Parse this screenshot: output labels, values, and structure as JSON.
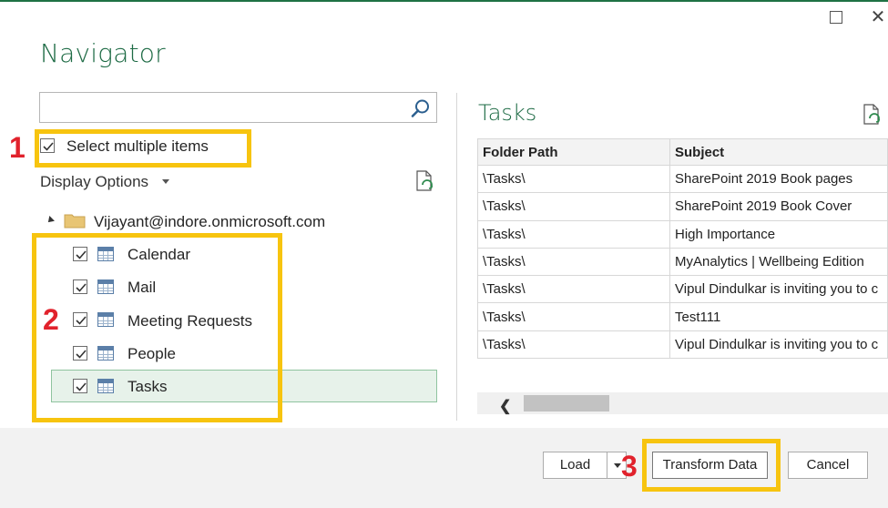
{
  "window": {
    "title": "Navigator",
    "maximize_icon": "maximize-icon",
    "close_icon": "close-icon",
    "close_glyph": "✕"
  },
  "search": {
    "value": "",
    "placeholder": "",
    "icon": "search-icon"
  },
  "select_multiple": {
    "label": "Select multiple items",
    "checked": true
  },
  "display_options": {
    "label": "Display Options"
  },
  "tree": {
    "root": {
      "label": "Vijayant@indore.onmicrosoft.com",
      "expanded": true,
      "icon": "folder-icon"
    },
    "items": [
      {
        "label": "Calendar",
        "checked": true,
        "selected": false,
        "icon": "table-icon"
      },
      {
        "label": "Mail",
        "checked": true,
        "selected": false,
        "icon": "table-icon"
      },
      {
        "label": "Meeting Requests",
        "checked": true,
        "selected": false,
        "icon": "table-icon"
      },
      {
        "label": "People",
        "checked": true,
        "selected": false,
        "icon": "table-icon"
      },
      {
        "label": "Tasks",
        "checked": true,
        "selected": true,
        "icon": "table-icon"
      }
    ]
  },
  "preview": {
    "title": "Tasks",
    "columns": [
      "Folder Path",
      "Subject"
    ],
    "rows": [
      [
        "\\Tasks\\",
        "SharePoint 2019 Book pages"
      ],
      [
        "\\Tasks\\",
        "SharePoint 2019 Book Cover"
      ],
      [
        "\\Tasks\\",
        "High Importance"
      ],
      [
        "\\Tasks\\",
        "MyAnalytics | Wellbeing Edition"
      ],
      [
        "\\Tasks\\",
        "Vipul Dindulkar is inviting you to c"
      ],
      [
        "\\Tasks\\",
        "Test111"
      ],
      [
        "\\Tasks\\",
        "Vipul Dindulkar is inviting you to c"
      ]
    ]
  },
  "annotations": {
    "step1": "1",
    "step2": "2",
    "step3": "3",
    "box_color": "#f7c40f",
    "number_color": "#e1222c"
  },
  "footer": {
    "load_label": "Load",
    "transform_label": "Transform Data",
    "cancel_label": "Cancel"
  },
  "colors": {
    "accent": "#1e6b45",
    "selection": "#e7f2ea"
  }
}
